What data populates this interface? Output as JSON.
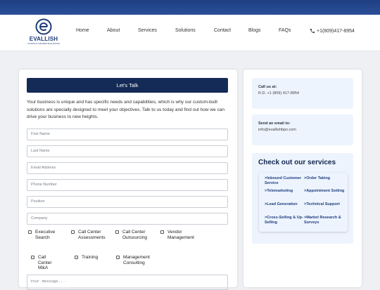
{
  "brand": {
    "name": "EVALLISH",
    "tagline": "CONTACT CENTER SOLUTIONS"
  },
  "nav": {
    "items": [
      "Home",
      "About",
      "Services",
      "Solutions",
      "Contact",
      "Blogs",
      "FAQs"
    ],
    "phone": "+1(809)417-8954"
  },
  "form": {
    "header": "Let's Talk",
    "intro": "Your business is unique and has specific needs and capabilities, which is why our custom-built solutions are specially designed to meet your objectives. Talk to us today and find out how we can drive your business to new heights.",
    "fields": {
      "first_name": "First Name",
      "last_name": "Last Name",
      "email": "Email Address",
      "phone": "Phone Number",
      "position": "Position",
      "company": "Company"
    },
    "checkboxes": {
      "executive_search": "Executive Search",
      "call_center_assessments": "Call Center Assessments",
      "call_center_outsourcing": "Call Center Outsourcing",
      "vendor_management": "Vendor Management",
      "call_center_ma": "Call Center M&A",
      "training": "Training",
      "management_consulting": "Management Consulting"
    },
    "message_placeholder": "Your message..."
  },
  "contact": {
    "call_title": "Call us at:",
    "call_value": "R.D. +1 (809) 417-8954",
    "email_title": "Send an email to:",
    "email_value": "info@evallishbpo.com"
  },
  "services": {
    "title": "Check out our services",
    "items": {
      "inbound": ">Inbound Customer Service",
      "order": ">Order Taking",
      "telemarketing": ">Telemarketing",
      "appointment": ">Appointment Setting",
      "lead": ">Lead Generation",
      "technical": ">Technical Support",
      "cross": ">Cross-Selling & Up-Selling",
      "market": ">Market Research & Surveys"
    }
  },
  "colors": {
    "primary": "#142b57",
    "accent": "#1e3f80",
    "panel": "#eef4fd"
  }
}
